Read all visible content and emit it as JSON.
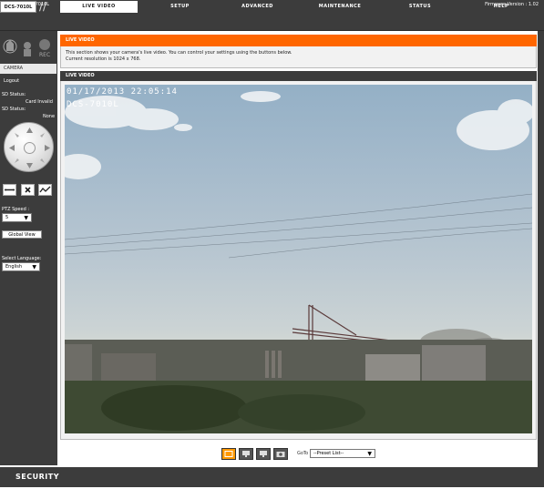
{
  "header": {
    "product": "Product: DCS-7010L",
    "firmware": "Firmware Version : 1.02",
    "model_tab": "DCS-7010L"
  },
  "nav": {
    "tabs": [
      {
        "label": "LIVE VIDEO",
        "active": true
      },
      {
        "label": "SETUP",
        "active": false
      },
      {
        "label": "ADVANCED",
        "active": false
      },
      {
        "label": "MAINTENANCE",
        "active": false
      },
      {
        "label": "STATUS",
        "active": false
      },
      {
        "label": "HELP",
        "active": false
      }
    ]
  },
  "sidebar": {
    "rec_label": "REC",
    "camera_label": "CAMERA",
    "logout": "Logout",
    "sd_status_label": "SD Status:",
    "sd_status_value": "Card Invalid",
    "sd_status2_label": "SD Status:",
    "sd_status2_value": "None",
    "ptz_speed_label": "PTZ Speed :",
    "ptz_speed_value": "5",
    "global_view": "Global View",
    "language_label": "Select Language:",
    "language_value": "English"
  },
  "live_video_panel": {
    "title": "LIVE VIDEO",
    "description_line1": "This section shows your camera's live video. You can control your settings using the buttons below.",
    "description_line2": "Current resolution is 1024 x 768."
  },
  "video": {
    "title": "LIVE VIDEO",
    "osd_timestamp": "01/17/2013 22:05:14",
    "osd_camera_name": "DCS-7010L"
  },
  "toolbar": {
    "goto_label": "GoTo",
    "preset_value": "--Preset List--"
  },
  "footer": {
    "brand": "SECURITY"
  },
  "colors": {
    "accent": "#ff6600",
    "dark": "#3c3c3c"
  }
}
